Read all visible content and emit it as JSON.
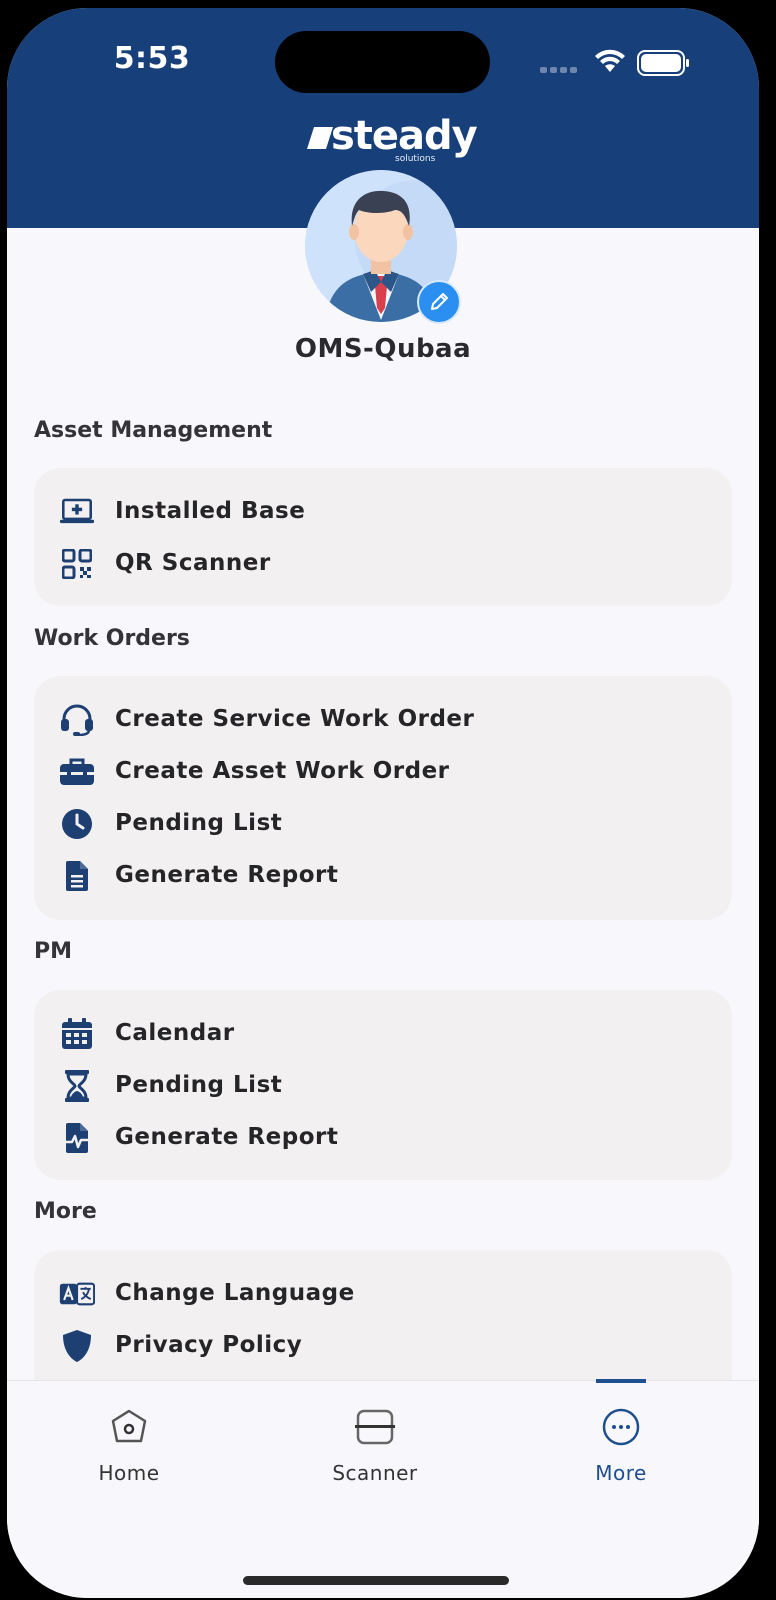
{
  "status_bar": {
    "time": "5:53"
  },
  "brand": {
    "name": "steady",
    "tagline": "solutions"
  },
  "profile": {
    "name": "OMS-Qubaa"
  },
  "sections": [
    {
      "title": "Asset Management",
      "items": [
        {
          "label": "Installed Base",
          "icon": "laptop-medical-icon"
        },
        {
          "label": "QR Scanner",
          "icon": "qr-code-icon"
        }
      ]
    },
    {
      "title": "Work Orders",
      "items": [
        {
          "label": "Create Service Work Order",
          "icon": "headset-icon"
        },
        {
          "label": "Create Asset Work Order",
          "icon": "toolbox-icon"
        },
        {
          "label": "Pending List",
          "icon": "clock-icon"
        },
        {
          "label": "Generate Report",
          "icon": "document-icon"
        }
      ]
    },
    {
      "title": "PM",
      "items": [
        {
          "label": "Calendar",
          "icon": "calendar-icon"
        },
        {
          "label": "Pending List",
          "icon": "hourglass-icon"
        },
        {
          "label": "Generate Report",
          "icon": "medical-file-icon"
        }
      ]
    },
    {
      "title": "More",
      "items": [
        {
          "label": "Change Language",
          "icon": "language-icon"
        },
        {
          "label": "Privacy Policy",
          "icon": "shield-icon"
        }
      ]
    }
  ],
  "tabs": [
    {
      "label": "Home",
      "icon": "home-icon",
      "active": false
    },
    {
      "label": "Scanner",
      "icon": "scanner-icon",
      "active": false
    },
    {
      "label": "More",
      "icon": "more-icon",
      "active": true
    }
  ],
  "colors": {
    "header": "#173f79",
    "accent": "#1f4f8f",
    "icon": "#1d3f72",
    "edit_badge": "#2a8ff0",
    "card": "#f2f0f1",
    "background": "#f8f8fc"
  }
}
